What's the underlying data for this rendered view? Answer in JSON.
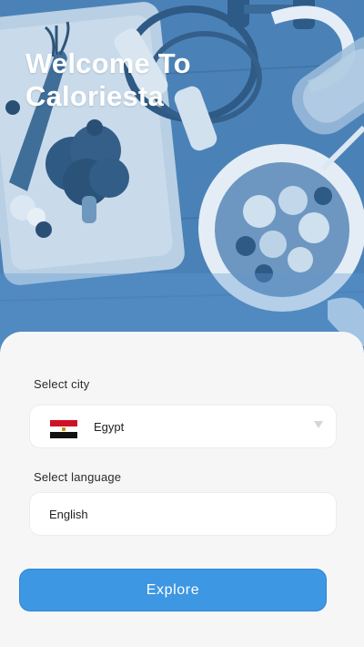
{
  "hero": {
    "title_line1": "Welcome To",
    "title_line2": "Caloriesta"
  },
  "form": {
    "city_label": "Select city",
    "city_value": "Egypt",
    "city_flag_icon": "egypt-flag-icon",
    "language_label": "Select language",
    "language_value": "English"
  },
  "actions": {
    "explore_label": "Explore"
  },
  "colors": {
    "accent": "#3d97e2",
    "sheet_background": "#f6f6f6",
    "hero_tint": "#4a83ba"
  }
}
